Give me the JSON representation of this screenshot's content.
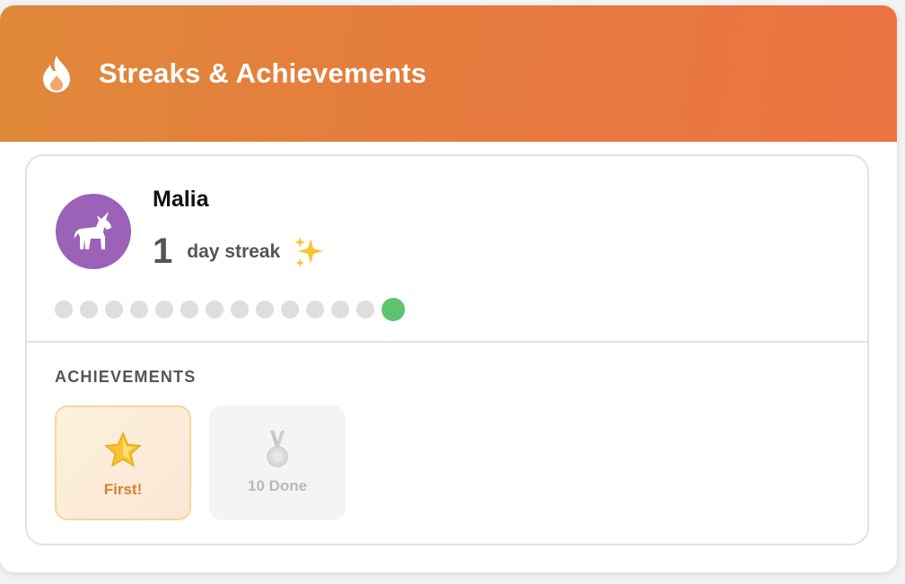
{
  "header": {
    "title": "Streaks & Achievements",
    "icon": "flame-icon",
    "gradient": [
      "#e0893a",
      "#ec7342"
    ]
  },
  "user": {
    "name": "Malia",
    "avatar_icon": "unicorn-icon",
    "avatar_color": "#9b62b8",
    "streak_count": "1",
    "streak_label": "day streak",
    "streak_icon": "sparkles-icon"
  },
  "streak_days": {
    "total": 14,
    "active_count": 1,
    "active_color": "#5cc46e",
    "inactive_color": "#dedede"
  },
  "achievements": {
    "title": "ACHIEVEMENTS",
    "items": [
      {
        "label": "First!",
        "icon": "star-icon",
        "earned": true
      },
      {
        "label": "10 Done",
        "icon": "medal-icon",
        "earned": false
      }
    ]
  }
}
